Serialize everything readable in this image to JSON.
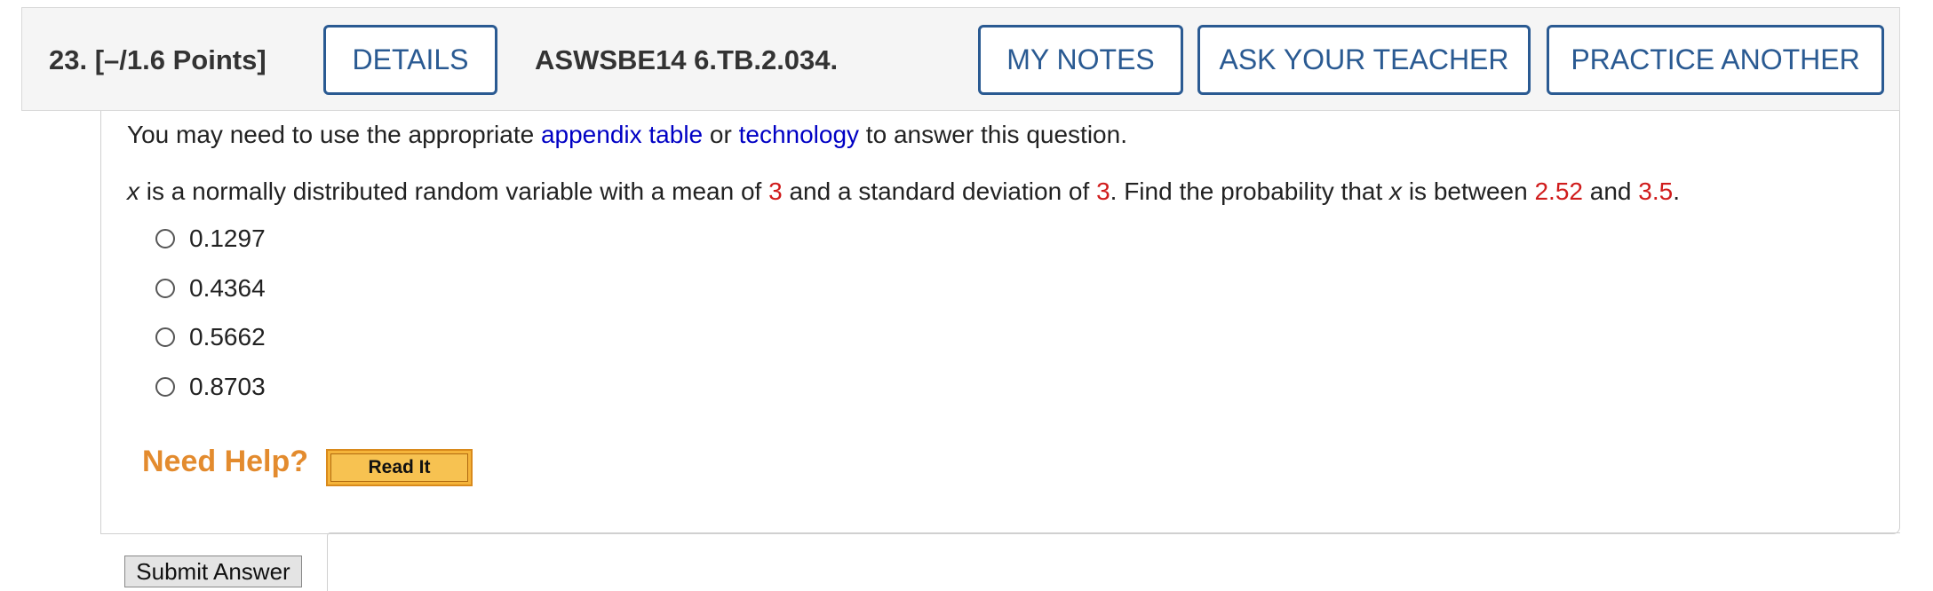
{
  "header": {
    "question_number": "23.",
    "points": "[–/1.6 Points]",
    "details_label": "DETAILS",
    "question_code": "ASWSBE14 6.TB.2.034.",
    "my_notes_label": "MY NOTES",
    "ask_teacher_label": "ASK YOUR TEACHER",
    "practice_label": "PRACTICE ANOTHER"
  },
  "intro": {
    "before": "You may need to use the appropriate ",
    "link1": "appendix table",
    "middle": " or ",
    "link2": "technology",
    "after": " to answer this question."
  },
  "question": {
    "x1": "x",
    "t1": " is a normally distributed random variable with a mean of ",
    "mean": "3",
    "t2": " and a standard deviation of ",
    "sd": "3",
    "t3": ". Find the probability that ",
    "x2": "x",
    "t4": " is between ",
    "low": "2.52",
    "t5": " and ",
    "high": "3.5",
    "t6": "."
  },
  "choices": [
    "0.1297",
    "0.4364",
    "0.5662",
    "0.8703"
  ],
  "help": {
    "label": "Need Help?",
    "read_it": "Read It"
  },
  "submit_label": "Submit Answer",
  "colors": {
    "button_border": "#2a5a92",
    "link": "#0000c4",
    "highlight": "#d01c1c",
    "help": "#e38b2e"
  }
}
